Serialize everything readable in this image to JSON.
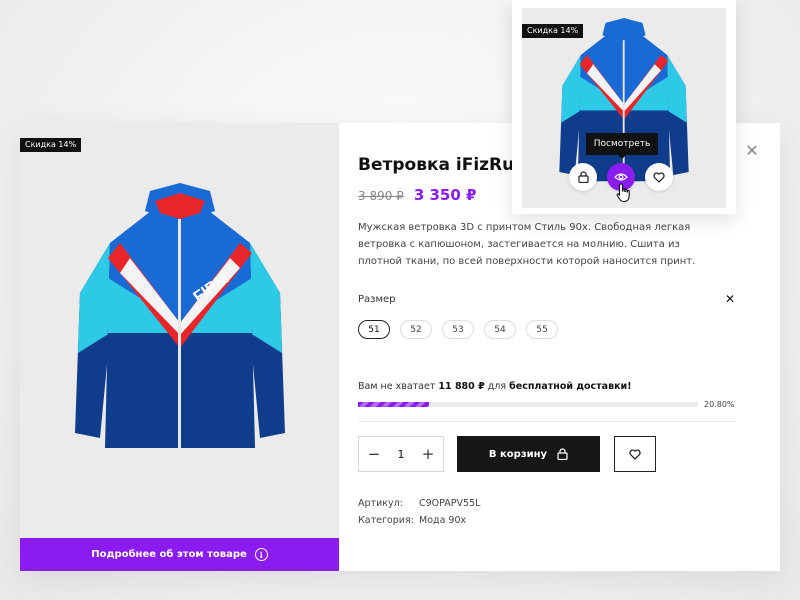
{
  "product": {
    "badge": "Скидка 14%",
    "title": "Ветровка iFizRuk",
    "old_price": "3 890 ₽",
    "new_price": "3 350 ₽",
    "description": "Мужская ветровка 3D с принтом Стиль 90х. Свободная легкая ветровка с капюшоном, застегивается на молнию. Сшита из плотной ткани, по всей поверхности которой наносится принт.",
    "brand_print": "FIRM"
  },
  "size": {
    "label": "Размер",
    "clear_icon": "close-icon",
    "options": [
      "51",
      "52",
      "53",
      "54",
      "55"
    ],
    "selected": "51"
  },
  "shipping": {
    "prefix": "Вам не хватает",
    "amount": "11 880 ₽",
    "middle": "для",
    "target": "бесплатной доставки!",
    "progress_label": "20.80%",
    "progress_percent": 20.8
  },
  "cart": {
    "qty_minus": "−",
    "qty_value": "1",
    "qty_plus": "+",
    "add_label": "В корзину"
  },
  "meta": {
    "sku_label": "Артикул:",
    "sku_value": "C9OPAPV55L",
    "category_label": "Категория:",
    "category_value": "Мода 90х"
  },
  "more_button": "Подробнее об этом товаре",
  "card": {
    "badge": "Скидка 14%",
    "tooltip": "Посмотреть"
  },
  "colors": {
    "accent": "#8a1cf0",
    "dark": "#161616",
    "jacket_navy": "#0f3d8c",
    "jacket_blue": "#1a6ad6",
    "jacket_cyan": "#2ec9e6",
    "jacket_red": "#e8262a"
  }
}
